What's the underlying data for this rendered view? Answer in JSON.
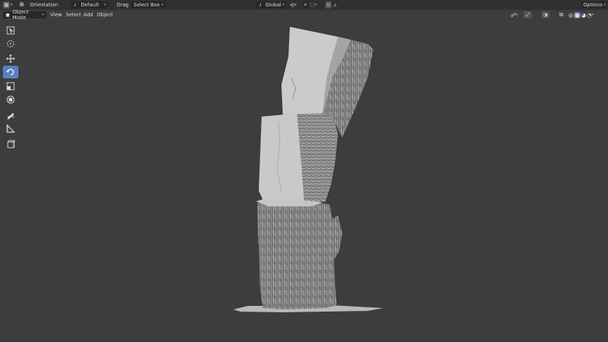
{
  "header": {
    "orientation_label": "Orientation",
    "default_label": "Default",
    "drag_label": "Drag",
    "select_box_label": "Select Box",
    "global_label": "Global",
    "options_label": "Options"
  },
  "viewport_header": {
    "mode_label": "Object Mode",
    "menus": [
      "View",
      "Select",
      "Add",
      "Object"
    ]
  },
  "toolbar": {
    "tools": [
      {
        "name": "select-box-tool",
        "icon": "select-box-icon",
        "active": false
      },
      {
        "name": "cursor-tool",
        "icon": "cursor-icon",
        "active": false
      },
      {
        "name": "move-tool",
        "icon": "move-icon",
        "active": false
      },
      {
        "name": "rotate-tool",
        "icon": "rotate-icon",
        "active": true
      },
      {
        "name": "scale-tool",
        "icon": "scale-icon",
        "active": false
      },
      {
        "name": "transform-tool",
        "icon": "transform-icon",
        "active": false
      },
      {
        "name": "annotate-tool",
        "icon": "annotate-icon",
        "active": false
      },
      {
        "name": "measure-tool",
        "icon": "measure-icon",
        "active": false
      },
      {
        "name": "add-cube-tool",
        "icon": "add-cube-icon",
        "active": false
      }
    ]
  },
  "colors": {
    "viewport_bg": "#3d3d3d",
    "header_bg": "#303030",
    "active_tool": "#5680c2",
    "mesh_light": "#c9c9c9",
    "mesh_dark": "#8a8a8a"
  }
}
